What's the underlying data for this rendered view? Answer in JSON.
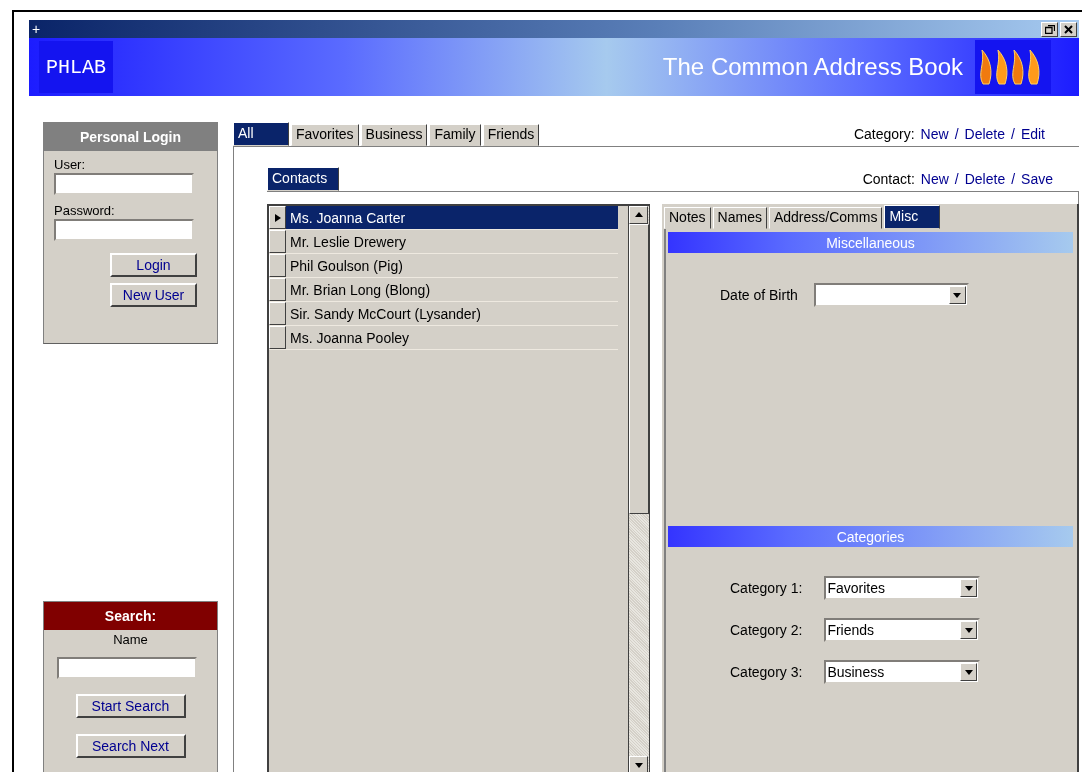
{
  "title_bar": {
    "icon": "+"
  },
  "banner": {
    "logo": "PHLAB",
    "title": "The Common Address Book"
  },
  "login": {
    "title": "Personal Login",
    "fields": [
      {
        "label": "User:"
      },
      {
        "label": "Password:"
      }
    ],
    "buttons": [
      "Login",
      "New User"
    ]
  },
  "search": {
    "title": "Search:",
    "label": "Name",
    "buttons": [
      "Start Search",
      "Search Next"
    ]
  },
  "category_tabs": [
    {
      "label": "All",
      "selected": true
    },
    {
      "label": "Favorites",
      "selected": false
    },
    {
      "label": "Business",
      "selected": false
    },
    {
      "label": "Family",
      "selected": false
    },
    {
      "label": "Friends",
      "selected": false
    }
  ],
  "category_actions": {
    "label": "Category:",
    "links": [
      "New",
      "Delete",
      "Edit"
    ],
    "separator": "/"
  },
  "contact_tabs": [
    {
      "label": "Contacts",
      "selected": true
    }
  ],
  "contact_actions": {
    "label": "Contact:",
    "links": [
      "New",
      "Delete",
      "Save"
    ],
    "separator": "/"
  },
  "contacts": [
    {
      "name": "Ms. Joanna Carter",
      "selected": true
    },
    {
      "name": "Mr. Leslie Drewery",
      "selected": false
    },
    {
      "name": "Phil Goulson (Pig)",
      "selected": false
    },
    {
      "name": "Mr. Brian Long (Blong)",
      "selected": false
    },
    {
      "name": "Sir. Sandy McCourt (Lysander)",
      "selected": false
    },
    {
      "name": "Ms. Joanna Pooley",
      "selected": false
    }
  ],
  "detail_tabs": [
    {
      "label": "Notes",
      "selected": false
    },
    {
      "label": "Names",
      "selected": false
    },
    {
      "label": "Address/Comms",
      "selected": false
    },
    {
      "label": "Misc",
      "selected": true
    }
  ],
  "misc": {
    "title": "Miscellaneous",
    "date_of_birth": {
      "label": "Date of Birth"
    }
  },
  "categories": {
    "title": "Categories",
    "rows": [
      {
        "label": "Category 1:",
        "value": "Favorites"
      },
      {
        "label": "Category 2:",
        "value": "Friends"
      },
      {
        "label": "Category 3:",
        "value": "Business"
      }
    ]
  }
}
